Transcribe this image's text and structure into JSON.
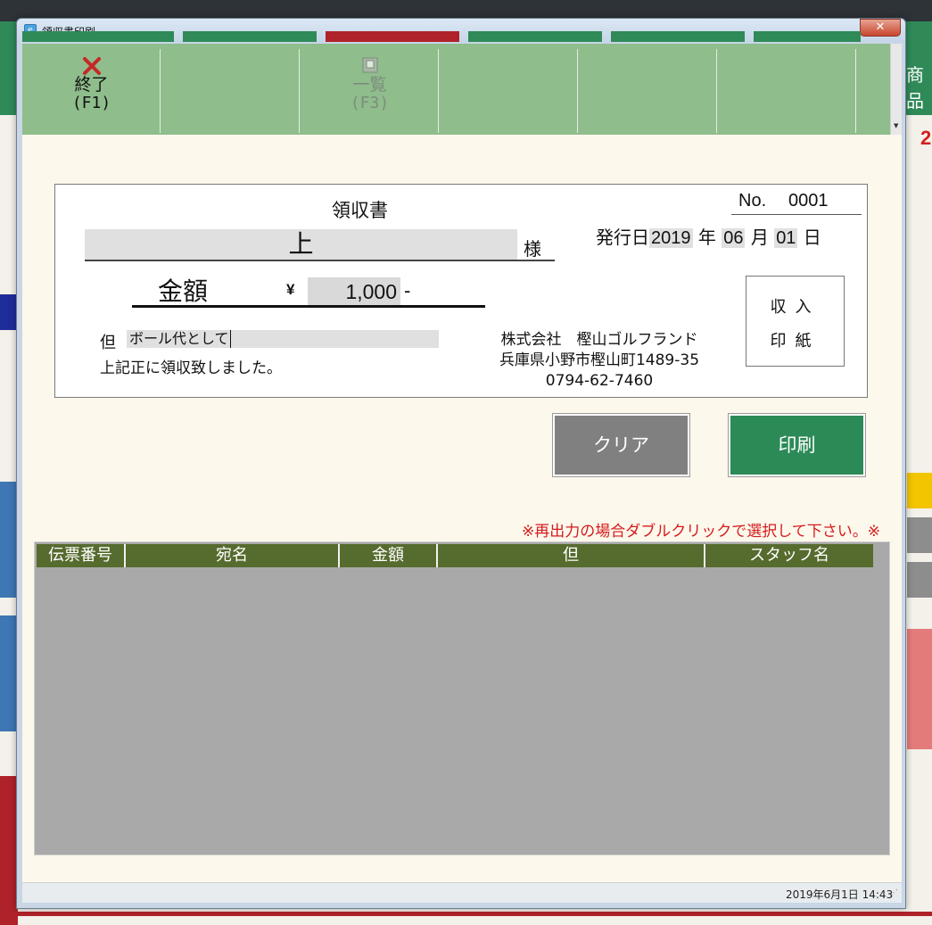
{
  "window": {
    "title": "領収書印刷",
    "close_label": "✕"
  },
  "background_app": {
    "right_label": "商品",
    "right_red_text": "2"
  },
  "toolbar": {
    "buttons": [
      {
        "label": "終了",
        "key": "(F1)",
        "icon": "close-x-icon",
        "enabled": true
      },
      {
        "label": "",
        "key": "",
        "icon": "",
        "enabled": true
      },
      {
        "label": "一覧",
        "key": "(F3)",
        "icon": "list-icon",
        "enabled": false
      },
      {
        "label": "",
        "key": "",
        "icon": "",
        "enabled": true
      },
      {
        "label": "",
        "key": "",
        "icon": "",
        "enabled": true
      },
      {
        "label": "",
        "key": "",
        "icon": "",
        "enabled": true
      }
    ]
  },
  "receipt": {
    "title": "領収書",
    "no_label": "No.",
    "no_value": "0001",
    "recipient": "上",
    "honorific": "様",
    "issue_label": "発行日",
    "year": "2019",
    "year_unit": "年",
    "month": "06",
    "month_unit": "月",
    "day": "01",
    "day_unit": "日",
    "amount_label": "金額",
    "currency": "¥",
    "amount": "1,000",
    "amount_suffix": "-",
    "purpose_label": "但",
    "purpose": "ボール代として",
    "received_text": "上記正に領収致しました。",
    "company_name": "株式会社　樫山ゴルフランド",
    "company_address": "兵庫県小野市樫山町1489-35",
    "company_phone": "0794-62-7460",
    "stamp_line1": "収入",
    "stamp_line2": "印紙"
  },
  "actions": {
    "clear_label": "クリア",
    "print_label": "印刷"
  },
  "notice": "※再出力の場合ダブルクリックで選択して下さい。※",
  "grid": {
    "columns": [
      "伝票番号",
      "宛名",
      "金額",
      "但",
      "スタッフ名"
    ],
    "rows": []
  },
  "status": {
    "datetime": "2019年6月1日 14:43"
  },
  "colors": {
    "toolbar_bg": "#8fbd8c",
    "print_button": "#2c8a57",
    "clear_button": "#808080",
    "grid_header": "#566b2e",
    "notice_red": "#d41c1c"
  }
}
